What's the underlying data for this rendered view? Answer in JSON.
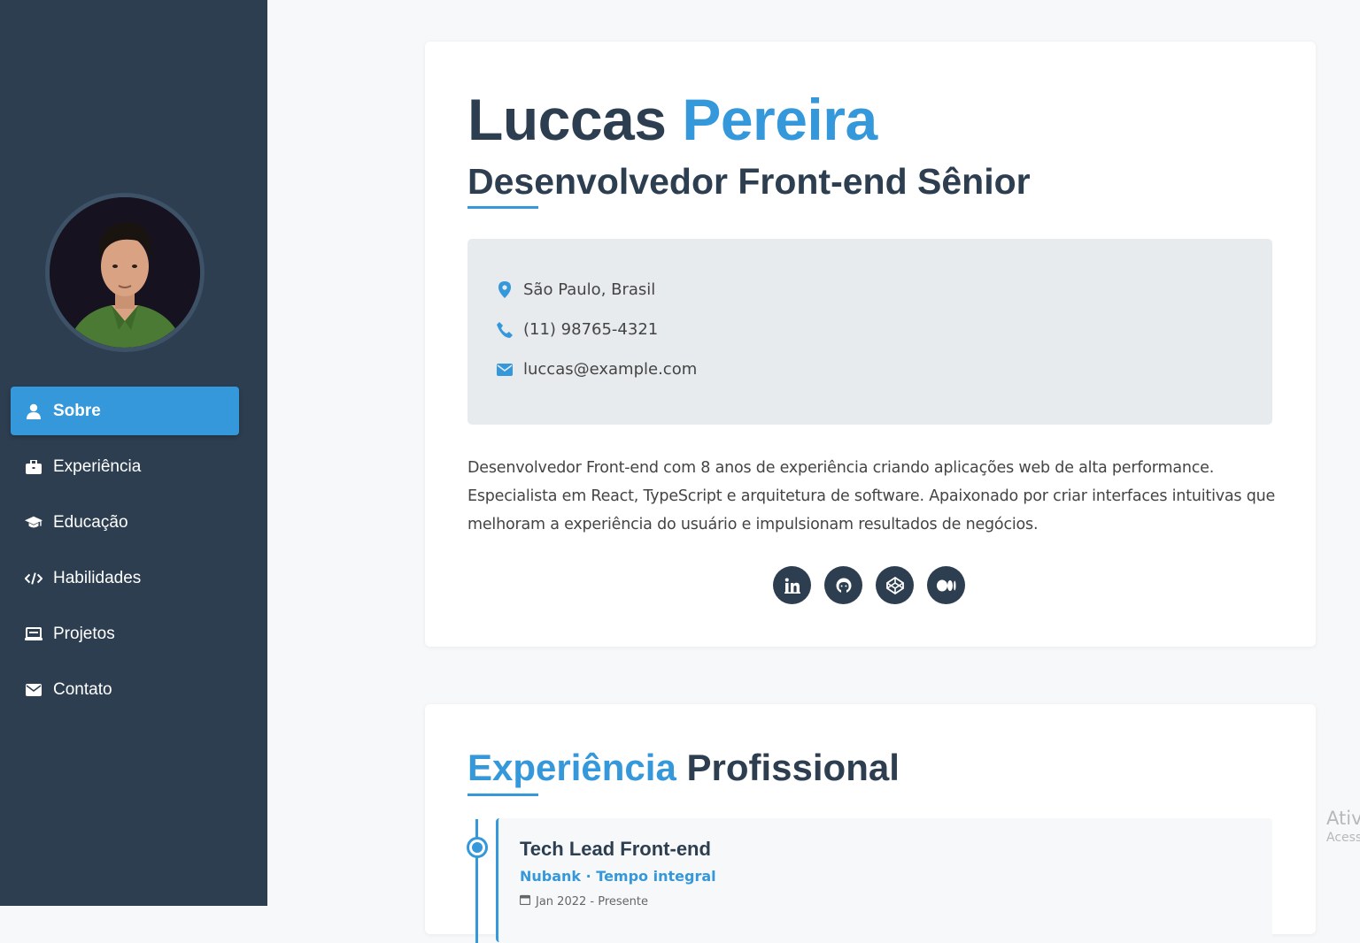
{
  "sidebar": {
    "avatar_alt": "Luccas Pereira",
    "items": [
      {
        "label": "Sobre",
        "icon": "user-icon",
        "active": true
      },
      {
        "label": "Experiência",
        "icon": "briefcase-icon"
      },
      {
        "label": "Educação",
        "icon": "graduation-cap-icon"
      },
      {
        "label": "Habilidades",
        "icon": "code-icon"
      },
      {
        "label": "Projetos",
        "icon": "laptop-icon"
      },
      {
        "label": "Contato",
        "icon": "envelope-icon"
      }
    ]
  },
  "profile": {
    "first_name": "Luccas",
    "last_name": "Pereira",
    "role": "Desenvolvedor Front-end Sênior",
    "location": "São Paulo, Brasil",
    "phone": "(11) 98765-4321",
    "email": "luccas@example.com",
    "bio": "Desenvolvedor Front-end com 8 anos de experiência criando aplicações web de alta performance. Especialista em React, TypeScript e arquitetura de software. Apaixonado por criar interfaces intuitivas que melhoram a experiência do usuário e impulsionam resultados de negócios.",
    "socials": [
      "linkedin-icon",
      "github-icon",
      "codepen-icon",
      "medium-icon"
    ]
  },
  "experience": {
    "title_highlight": "Experiência",
    "title_rest": "Profissional",
    "jobs": [
      {
        "title": "Tech Lead Front-end",
        "company": "Nubank · Tempo integral",
        "date": "Jan 2022 - Presente"
      }
    ]
  },
  "watermark": {
    "line1": "Ativ",
    "line2": "Acess"
  },
  "colors": {
    "sidebar": "#2c3e50",
    "accent": "#3498db",
    "info_bg": "#e8ebee"
  }
}
